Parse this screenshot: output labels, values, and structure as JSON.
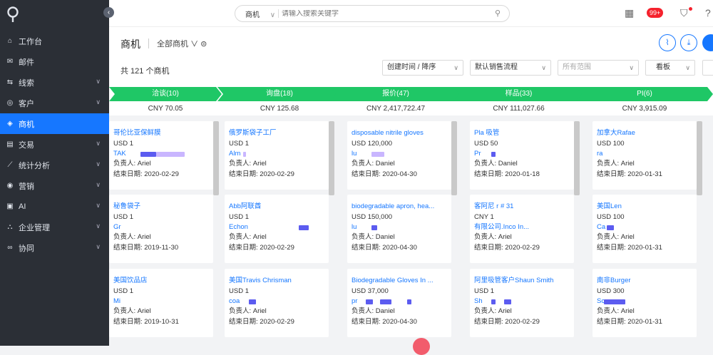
{
  "sidebar": {
    "collapse_icon": "chevron-left-icon",
    "items": [
      {
        "label": "工作台",
        "icon": "home-icon",
        "glyph": "⌂",
        "chev": false,
        "active": false
      },
      {
        "label": "邮件",
        "icon": "mail-icon",
        "glyph": "✉",
        "chev": false,
        "active": false
      },
      {
        "label": "线索",
        "icon": "clue-icon",
        "glyph": "⇆",
        "chev": true,
        "active": false
      },
      {
        "label": "客户",
        "icon": "customer-icon",
        "glyph": "◎",
        "chev": true,
        "active": false
      },
      {
        "label": "商机",
        "icon": "opportunity-icon",
        "glyph": "◈",
        "chev": false,
        "active": true
      },
      {
        "label": "交易",
        "icon": "trade-icon",
        "glyph": "▤",
        "chev": true,
        "active": false
      },
      {
        "label": "统计分析",
        "icon": "analytics-icon",
        "glyph": "⟋",
        "chev": true,
        "active": false
      },
      {
        "label": "营销",
        "icon": "marketing-icon",
        "glyph": "◉",
        "chev": true,
        "active": false
      },
      {
        "label": "AI",
        "icon": "ai-icon",
        "glyph": "▣",
        "chev": true,
        "active": false
      },
      {
        "label": "企业管理",
        "icon": "org-icon",
        "glyph": "⛬",
        "chev": true,
        "active": false
      },
      {
        "label": "协同",
        "icon": "collab-icon",
        "glyph": "∞",
        "chev": true,
        "active": false
      }
    ]
  },
  "topbar": {
    "search_scope": "商机",
    "search_placeholder": "请输入搜索关键字",
    "notification_count": "99+"
  },
  "header": {
    "title": "商机",
    "filter_label": "全部商机",
    "chevron": "∨"
  },
  "toolbar": {
    "count_text": "共 121 个商机",
    "sort_value": "创建时间 / 降序",
    "process_value": "默认销售流程",
    "scope_placeholder": "所有范围",
    "view_value": "看板"
  },
  "stages": [
    {
      "label": "洽谈(10)",
      "amount": "CNY 70.05"
    },
    {
      "label": "询盘(18)",
      "amount": "CNY 125.68"
    },
    {
      "label": "报价(47)",
      "amount": "CNY 2,417,722.47"
    },
    {
      "label": "样品(33)",
      "amount": "CNY 111,027.66"
    },
    {
      "label": "PI(6)",
      "amount": "CNY 3,915.09"
    }
  ],
  "columns": [
    {
      "cards": [
        {
          "name": "哥伦比亚保鲜膜",
          "currency": "USD 1",
          "contact": "TAK",
          "owner": "负责人:  Ariel",
          "end": "结束日期:  2020-02-29"
        },
        {
          "name": "秘鲁袋子",
          "currency": "USD 1",
          "contact": "Gr",
          "owner": "负责人:  Ariel",
          "end": "结束日期:  2019-11-30"
        },
        {
          "name": "美国饮品店",
          "currency": "USD 1",
          "contact": "Mi",
          "owner": "负责人:  Ariel",
          "end": "结束日期:  2019-10-31"
        }
      ]
    },
    {
      "cards": [
        {
          "name": "俄罗斯袋子工厂",
          "currency": "USD 1",
          "contact": "Alm",
          "owner": "负责人:  Ariel",
          "end": "结束日期:  2020-02-29"
        },
        {
          "name": "Abb阿联酋",
          "currency": "USD 1",
          "contact": "Echon",
          "owner": "负责人:  Ariel",
          "end": "结束日期:  2020-02-29"
        },
        {
          "name": "美国Travis Chrisman",
          "currency": "USD 1",
          "contact": "coa",
          "owner": "负责人:  Ariel",
          "end": "结束日期:  2020-02-29"
        }
      ]
    },
    {
      "cards": [
        {
          "name": "disposable nitrile gloves",
          "currency": "USD 120,000",
          "contact": "lu",
          "owner": "负责人:  Daniel",
          "end": "结束日期:  2020-04-30"
        },
        {
          "name": "biodegradable apron, hea...",
          "currency": "USD 150,000",
          "contact": "lu",
          "owner": "负责人:  Daniel",
          "end": "结束日期:  2020-04-30"
        },
        {
          "name": "Biodegradable Gloves In ...",
          "currency": "USD 37,000",
          "contact": "pr",
          "owner": "负责人:  Daniel",
          "end": "结束日期:  2020-04-30"
        }
      ]
    },
    {
      "cards": [
        {
          "name": "Pla 吸管",
          "currency": "USD 50",
          "contact": "Pr",
          "owner": "负责人:  Daniel",
          "end": "结束日期:  2020-01-18"
        },
        {
          "name": "客阿尼 r # 31",
          "currency": "CNY 1",
          "contact": "有限公司.Inco In...",
          "owner": "负责人:  Ariel",
          "end": "结束日期:  2020-02-29"
        },
        {
          "name": "阿里吸管客户Shaun Smith",
          "currency": "USD 1",
          "contact": "Sh",
          "owner": "负责人:  Ariel",
          "end": "结束日期:  2020-02-29"
        }
      ]
    },
    {
      "cards": [
        {
          "name": "加拿大Rafae",
          "currency": "USD 100",
          "contact": "ra",
          "owner": "负责人:  Ariel",
          "end": "结束日期:  2020-01-31"
        },
        {
          "name": "美国Len",
          "currency": "USD 100",
          "contact": "Ca",
          "owner": "负责人:  Ariel",
          "end": "结束日期:  2020-01-31"
        },
        {
          "name": "南非Burger",
          "currency": "USD 300",
          "contact": "Scr",
          "owner": "负责人:  Ariel",
          "end": "结束日期:  2020-01-31"
        }
      ]
    }
  ],
  "colors": {
    "accent": "#1677ff",
    "stage": "#1fc766",
    "sidebar": "#2b2f36"
  }
}
